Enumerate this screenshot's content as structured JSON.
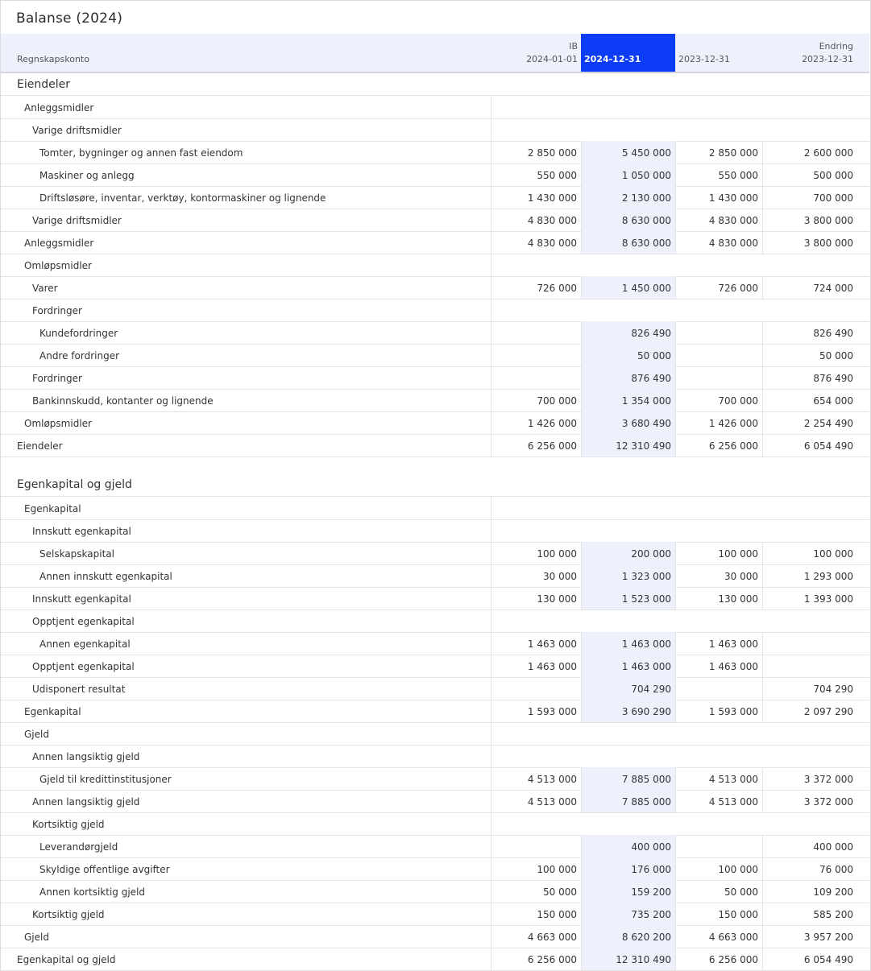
{
  "title": "Balanse (2024)",
  "header": {
    "account_label": "Regnskapskonto",
    "ib_top": "IB",
    "ib_date": "2024-01-01",
    "current_date": "2024-12-31",
    "prior_date": "2023-12-31",
    "change_top": "Endring",
    "change_date": "2023-12-31"
  },
  "sections": {
    "assets_title": "Eiendeler",
    "equity_title": "Egenkapital og gjeld"
  },
  "rows": [
    {
      "label": "Anleggsmidler",
      "level": 1,
      "ib": "",
      "cur": "",
      "prev": "",
      "chg": "",
      "values": false
    },
    {
      "label": "Varige driftsmidler",
      "level": 2,
      "ib": "",
      "cur": "",
      "prev": "",
      "chg": "",
      "values": false
    },
    {
      "label": "Tomter, bygninger og annen fast eiendom",
      "level": 3,
      "ib": "2 850 000",
      "cur": "5 450 000",
      "prev": "2 850 000",
      "chg": "2 600 000",
      "values": true
    },
    {
      "label": "Maskiner og anlegg",
      "level": 3,
      "ib": "550 000",
      "cur": "1 050 000",
      "prev": "550 000",
      "chg": "500 000",
      "values": true
    },
    {
      "label": "Driftsløsøre, inventar, verktøy, kontormaskiner og lignende",
      "level": 3,
      "ib": "1 430 000",
      "cur": "2 130 000",
      "prev": "1 430 000",
      "chg": "700 000",
      "values": true
    },
    {
      "label": "Varige driftsmidler",
      "level": 2,
      "ib": "4 830 000",
      "cur": "8 630 000",
      "prev": "4 830 000",
      "chg": "3 800 000",
      "values": true
    },
    {
      "label": "Anleggsmidler",
      "level": 1,
      "ib": "4 830 000",
      "cur": "8 630 000",
      "prev": "4 830 000",
      "chg": "3 800 000",
      "values": true
    },
    {
      "label": "Omløpsmidler",
      "level": 1,
      "ib": "",
      "cur": "",
      "prev": "",
      "chg": "",
      "values": false
    },
    {
      "label": "Varer",
      "level": 2,
      "ib": "726 000",
      "cur": "1 450 000",
      "prev": "726 000",
      "chg": "724 000",
      "values": true
    },
    {
      "label": "Fordringer",
      "level": 2,
      "ib": "",
      "cur": "",
      "prev": "",
      "chg": "",
      "values": false
    },
    {
      "label": "Kundefordringer",
      "level": 3,
      "ib": "",
      "cur": "826 490",
      "prev": "",
      "chg": "826 490",
      "values": true
    },
    {
      "label": "Andre fordringer",
      "level": 3,
      "ib": "",
      "cur": "50 000",
      "prev": "",
      "chg": "50 000",
      "values": true
    },
    {
      "label": "Fordringer",
      "level": 2,
      "ib": "",
      "cur": "876 490",
      "prev": "",
      "chg": "876 490",
      "values": true
    },
    {
      "label": "Bankinnskudd, kontanter og lignende",
      "level": 2,
      "ib": "700 000",
      "cur": "1 354 000",
      "prev": "700 000",
      "chg": "654 000",
      "values": true
    },
    {
      "label": "Omløpsmidler",
      "level": 1,
      "ib": "1 426 000",
      "cur": "3 680 490",
      "prev": "1 426 000",
      "chg": "2 254 490",
      "values": true
    },
    {
      "label": "Eiendeler",
      "level": 0,
      "ib": "6 256 000",
      "cur": "12 310 490",
      "prev": "6 256 000",
      "chg": "6 054 490",
      "values": true
    },
    {
      "label": "Egenkapital",
      "level": 1,
      "ib": "",
      "cur": "",
      "prev": "",
      "chg": "",
      "values": false
    },
    {
      "label": "Innskutt egenkapital",
      "level": 2,
      "ib": "",
      "cur": "",
      "prev": "",
      "chg": "",
      "values": false
    },
    {
      "label": "Selskapskapital",
      "level": 3,
      "ib": "100 000",
      "cur": "200 000",
      "prev": "100 000",
      "chg": "100 000",
      "values": true
    },
    {
      "label": "Annen innskutt egenkapital",
      "level": 3,
      "ib": "30 000",
      "cur": "1 323 000",
      "prev": "30 000",
      "chg": "1 293 000",
      "values": true
    },
    {
      "label": "Innskutt egenkapital",
      "level": 2,
      "ib": "130 000",
      "cur": "1 523 000",
      "prev": "130 000",
      "chg": "1 393 000",
      "values": true
    },
    {
      "label": "Opptjent egenkapital",
      "level": 2,
      "ib": "",
      "cur": "",
      "prev": "",
      "chg": "",
      "values": false
    },
    {
      "label": "Annen egenkapital",
      "level": 3,
      "ib": "1 463 000",
      "cur": "1 463 000",
      "prev": "1 463 000",
      "chg": "",
      "values": true
    },
    {
      "label": "Opptjent egenkapital",
      "level": 2,
      "ib": "1 463 000",
      "cur": "1 463 000",
      "prev": "1 463 000",
      "chg": "",
      "values": true
    },
    {
      "label": "Udisponert resultat",
      "level": 2,
      "ib": "",
      "cur": "704 290",
      "prev": "",
      "chg": "704 290",
      "values": true
    },
    {
      "label": "Egenkapital",
      "level": 1,
      "ib": "1 593 000",
      "cur": "3 690 290",
      "prev": "1 593 000",
      "chg": "2 097 290",
      "values": true
    },
    {
      "label": "Gjeld",
      "level": 1,
      "ib": "",
      "cur": "",
      "prev": "",
      "chg": "",
      "values": false
    },
    {
      "label": "Annen langsiktig gjeld",
      "level": 2,
      "ib": "",
      "cur": "",
      "prev": "",
      "chg": "",
      "values": false
    },
    {
      "label": "Gjeld til kredittinstitusjoner",
      "level": 3,
      "ib": "4 513 000",
      "cur": "7 885 000",
      "prev": "4 513 000",
      "chg": "3 372 000",
      "values": true
    },
    {
      "label": "Annen langsiktig gjeld",
      "level": 2,
      "ib": "4 513 000",
      "cur": "7 885 000",
      "prev": "4 513 000",
      "chg": "3 372 000",
      "values": true
    },
    {
      "label": "Kortsiktig gjeld",
      "level": 2,
      "ib": "",
      "cur": "",
      "prev": "",
      "chg": "",
      "values": false
    },
    {
      "label": "Leverandørgjeld",
      "level": 3,
      "ib": "",
      "cur": "400 000",
      "prev": "",
      "chg": "400 000",
      "values": true
    },
    {
      "label": "Skyldige offentlige avgifter",
      "level": 3,
      "ib": "100 000",
      "cur": "176 000",
      "prev": "100 000",
      "chg": "76 000",
      "values": true
    },
    {
      "label": "Annen kortsiktig gjeld",
      "level": 3,
      "ib": "50 000",
      "cur": "159 200",
      "prev": "50 000",
      "chg": "109 200",
      "values": true
    },
    {
      "label": "Kortsiktig gjeld",
      "level": 2,
      "ib": "150 000",
      "cur": "735 200",
      "prev": "150 000",
      "chg": "585 200",
      "values": true
    },
    {
      "label": "Gjeld",
      "level": 1,
      "ib": "4 663 000",
      "cur": "8 620 200",
      "prev": "4 663 000",
      "chg": "3 957 200",
      "values": true
    },
    {
      "label": "Egenkapital og gjeld",
      "level": 0,
      "ib": "6 256 000",
      "cur": "12 310 490",
      "prev": "6 256 000",
      "chg": "6 054 490",
      "values": true
    }
  ]
}
